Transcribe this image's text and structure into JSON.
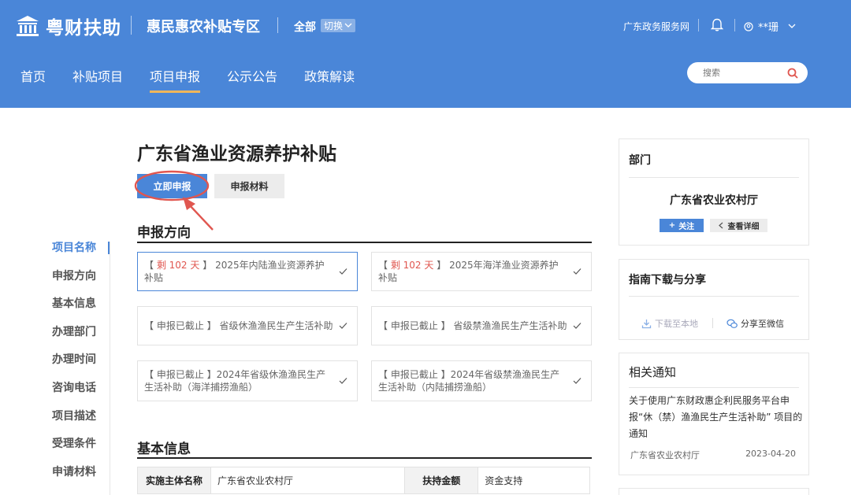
{
  "header": {
    "brand": "粤财扶助",
    "zone_title": "惠民惠农补贴专区",
    "region": "全部",
    "switch_label": "切换",
    "gov_link": "广东政务服务网",
    "user_name": "**珊",
    "nav": [
      "首页",
      "补贴项目",
      "项目申报",
      "公示公告",
      "政策解读"
    ],
    "active_nav": "项目申报",
    "search_placeholder": "搜索",
    "bg_color": "#4a86d8",
    "accent_color": "#f0b65a"
  },
  "anchor_nav": {
    "items": [
      "项目名称",
      "申报方向",
      "基本信息",
      "办理部门",
      "办理时间",
      "咨询电话",
      "项目描述",
      "受理条件",
      "申请材料"
    ],
    "active": "项目名称"
  },
  "main": {
    "title": "广东省渔业资源养护补贴",
    "apply_button": "立即申报",
    "materials_button": "申报材料",
    "direction_heading": "申报方向",
    "directions": [
      {
        "prefix": "【",
        "days": "剩 102 天",
        "suffix": "】",
        "name": "2025年内陆渔业资源养护补贴",
        "selected": true
      },
      {
        "prefix": "【",
        "days": "剩 102 天",
        "suffix": "】",
        "name": "2025年海洋渔业资源养护补贴",
        "selected": false
      },
      {
        "status": "【 申报已截止 】",
        "name": "省级休渔渔民生产生活补助",
        "selected": false
      },
      {
        "status": "【 申报已截止 】",
        "name": "省级禁渔渔民生产生活补助",
        "selected": false
      },
      {
        "status": "【 申报已截止 】",
        "name": "2024年省级休渔渔民生产生活补助（海洋捕捞渔船）",
        "selected": false
      },
      {
        "status": "【 申报已截止 】",
        "name": "2024年省级禁渔渔民生产生活补助（内陆捕捞渔船）",
        "selected": false
      }
    ],
    "basic_heading": "基本信息",
    "basic_info": {
      "entity_label": "实施主体名称",
      "entity_value": "广东省农业农村厅",
      "amount_label": "扶持金额",
      "amount_value": "资金支持"
    },
    "deadline_color": "#e0564f"
  },
  "sidebar": {
    "dept_heading": "部门",
    "dept_name": "广东省农业农村厅",
    "follow_label": "关注",
    "detail_label": "查看详细",
    "guide_heading": "指南下载与分享",
    "download_label": "下载至本地",
    "share_label": "分享至微信",
    "notice_heading": "相关通知",
    "notice_title": "关于使用广东财政惠企利民服务平台申报“休（禁）渔渔民生产生活补助” 项目的通知",
    "notice_source": "广东省农业农村厅",
    "notice_date": "2023-04-20"
  }
}
